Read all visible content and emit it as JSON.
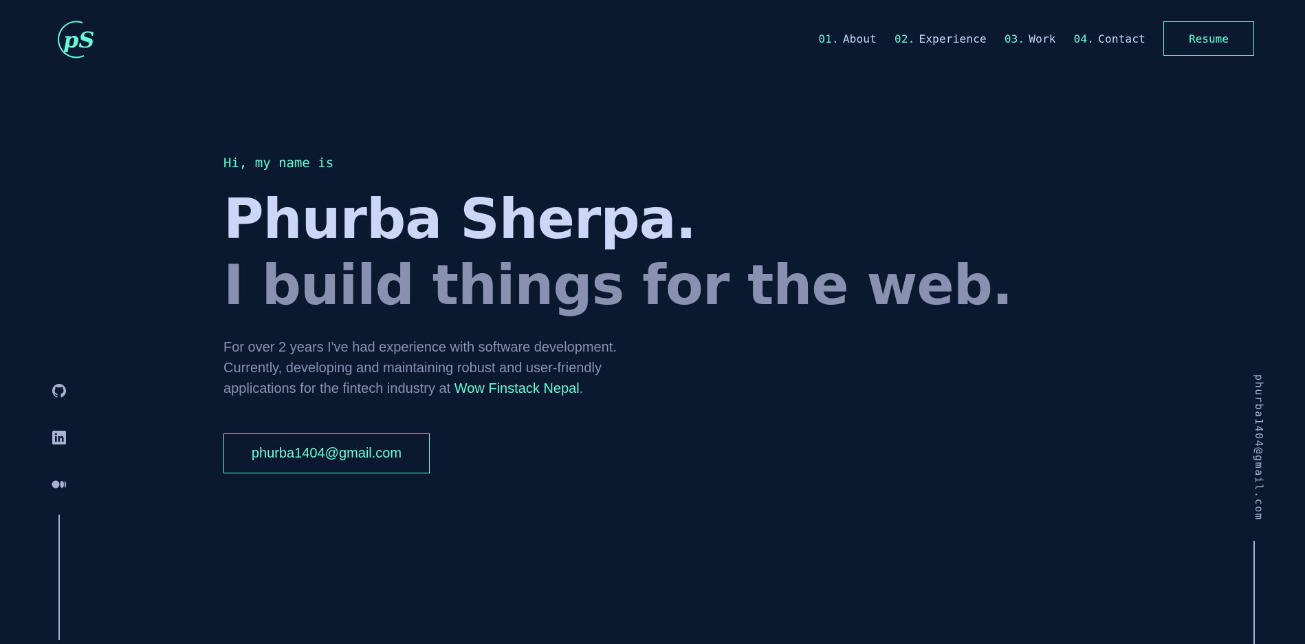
{
  "logo": {
    "text": "pS"
  },
  "nav": {
    "items": [
      {
        "num": "01.",
        "label": "About"
      },
      {
        "num": "02.",
        "label": "Experience"
      },
      {
        "num": "03.",
        "label": "Work"
      },
      {
        "num": "04.",
        "label": "Contact"
      }
    ],
    "resume_label": "Resume"
  },
  "hero": {
    "intro": "Hi, my name is",
    "name": "Phurba Sherpa.",
    "tagline": "I build things for the web.",
    "description_text": "For over 2 years I've had experience with software development. Currently, developing and maintaining robust and user-friendly applications for the fintech industry at ",
    "description_link": "Wow Finstack Nepal",
    "description_end": ".",
    "email_button": "phurba1404@gmail.com"
  },
  "socials": [
    {
      "icon": "github-icon"
    },
    {
      "icon": "linkedin-icon"
    },
    {
      "icon": "medium-icon"
    }
  ],
  "side_email": "phurba1404@gmail.com",
  "colors": {
    "background": "#0b1930",
    "accent": "#64ffda",
    "heading": "#ccd6f6",
    "text": "#8892b0",
    "muted": "#a8b2d1"
  }
}
